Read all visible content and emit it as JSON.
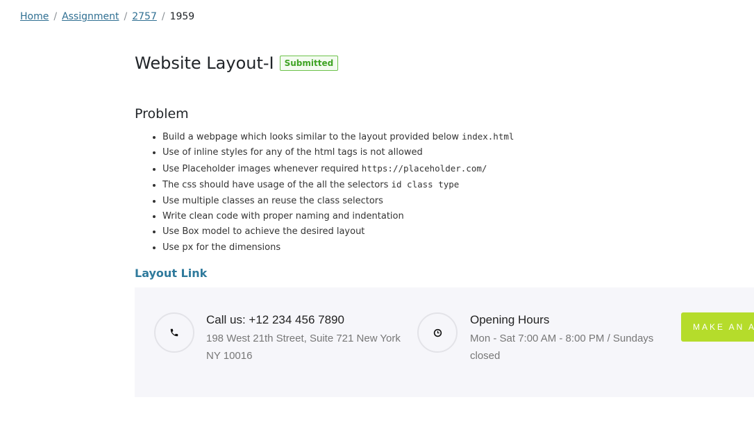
{
  "breadcrumb": {
    "items": [
      "Home",
      "Assignment",
      "2757"
    ],
    "separator": "/",
    "current": "1959"
  },
  "header": {
    "title": "Website Layout-I",
    "status": "Submitted"
  },
  "problem": {
    "heading": "Problem",
    "items": [
      {
        "text": "Build a webpage which looks similar to the layout provided below ",
        "code": "index.html"
      },
      {
        "text": "Use of inline styles for any of the html tags is not allowed",
        "code": ""
      },
      {
        "text": "Use Placeholder images whenever required ",
        "code": "https://placeholder.com/"
      },
      {
        "text": "The css should have usage of the all the selectors ",
        "code": "id class type"
      },
      {
        "text": "Use multiple classes an reuse the class selectors",
        "code": ""
      },
      {
        "text": "Write clean code with proper naming and indentation",
        "code": ""
      },
      {
        "text": "Use Box model to achieve the desired layout",
        "code": ""
      },
      {
        "text": "Use px for the dimensions",
        "code": ""
      }
    ]
  },
  "layout_link": {
    "label": "Layout Link"
  },
  "preview": {
    "call": {
      "icon": "phone-icon",
      "title": "Call us: +12 234 456 7890",
      "line1": "198 West 21th Street, Suite 721 New York",
      "line2": "NY 10016"
    },
    "hours": {
      "icon": "clock-icon",
      "title": "Opening Hours",
      "line1": "Mon - Sat 7:00 AM - 8:00 PM / Sundays",
      "line2": "closed"
    },
    "button_label": "MAKE AN APPOINTMENT",
    "colors": {
      "panel_bg": "#f6f6fa",
      "button_bg": "#b5dc2b"
    }
  }
}
